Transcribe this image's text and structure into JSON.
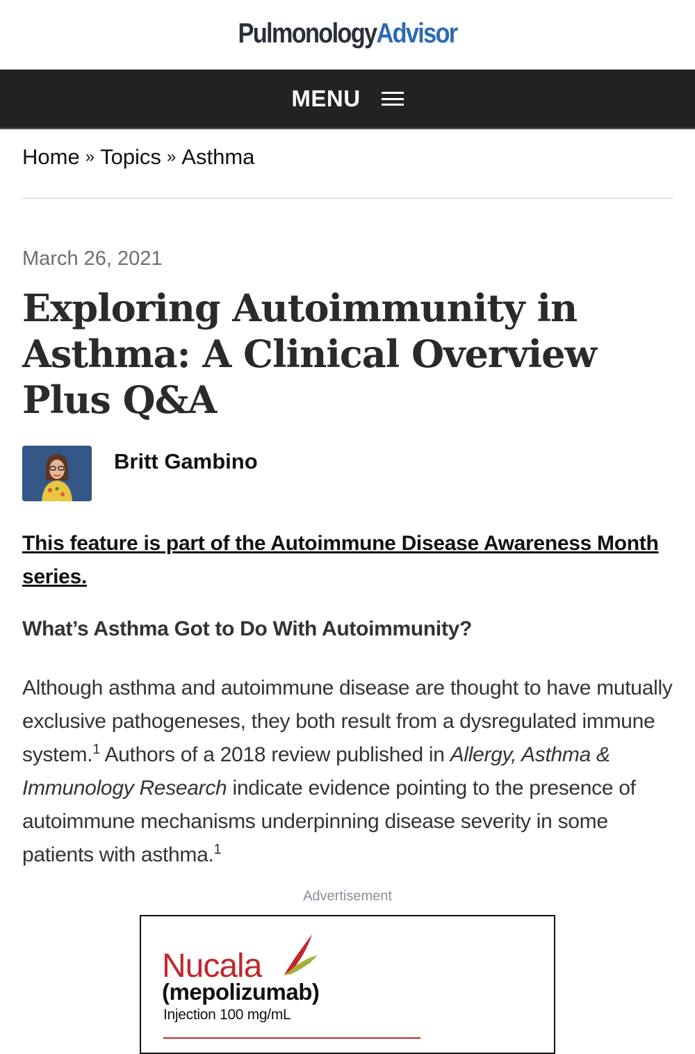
{
  "site": {
    "logo_part1": "Pulmonology",
    "logo_part2": "Advisor",
    "colors": {
      "logo_dark": "#2b2f38",
      "logo_blue": "#2d6bb2",
      "nav_bg": "#222222"
    }
  },
  "nav": {
    "menu_label": "MENU",
    "menu_icon": "hamburger-icon"
  },
  "breadcrumb": {
    "items": [
      "Home",
      "Topics",
      "Asthma"
    ],
    "separator": "»"
  },
  "article": {
    "date": "March 26, 2021",
    "title": "Exploring Autoimmunity in Asthma: A Clinical Overview Plus Q&A",
    "author": "Britt Gambino",
    "series_link": "This feature is part of the Autoimmune Disease Awareness Month series.",
    "subheading": "What’s Asthma Got to Do With Autoimmunity?",
    "body": {
      "part1": "Although asthma and autoimmune disease are thought to have mutually exclusive pathogeneses, they both result from a dysregulated immune system.",
      "ref1": "1",
      "part2": " Authors of a 2018 review published in ",
      "journal": "Allergy, Asthma & Immunology Research",
      "part3": " indicate evidence pointing to the presence of autoimmune mechanisms underpinning disease severity in some patients with asthma.",
      "ref2": "1"
    }
  },
  "ad": {
    "label": "Advertisement",
    "brand": "Nucala",
    "generic": "(mepolizumab)",
    "dose": "Injection 100 mg/mL",
    "brand_color": "#c1272d"
  }
}
